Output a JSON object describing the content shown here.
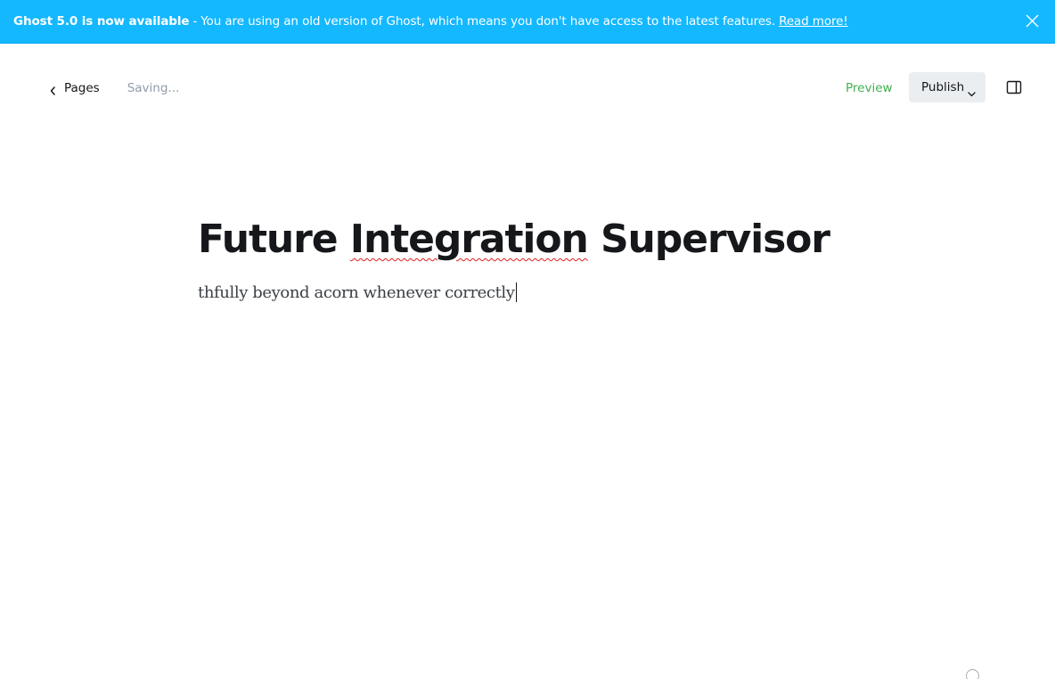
{
  "banner": {
    "title": "Ghost 5.0 is now available",
    "separator": "-",
    "message": "You are using an old version of Ghost, which means you don't have access to the latest features.",
    "link": "Read more!",
    "close_icon": "close-icon",
    "background": "#14b8ff"
  },
  "toolbar": {
    "back_label": "Pages",
    "back_icon": "chevron-left-icon",
    "status": "Saving...",
    "preview_label": "Preview",
    "publish_label": "Publish",
    "publish_icon": "chevron-down-icon",
    "sidebar_icon": "sidebar-toggle-icon"
  },
  "editor": {
    "title_before": "Future ",
    "title_misspelled": "Integration",
    "title_after": " Supervisor",
    "body": "thfully beyond acorn whenever correctly"
  },
  "colors": {
    "accent_green": "#3eb24e",
    "text": "#15171a",
    "muted": "#8e9cac",
    "publish_bg": "#ebeef0"
  }
}
